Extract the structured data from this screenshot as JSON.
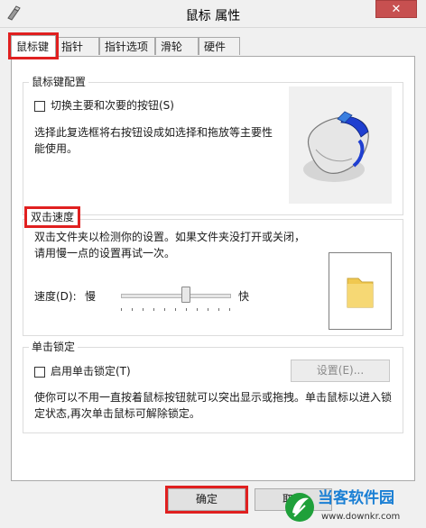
{
  "window": {
    "title": "鼠标 属性",
    "close_glyph": "✕"
  },
  "tabs": [
    {
      "label": "鼠标键"
    },
    {
      "label": "指针"
    },
    {
      "label": "指针选项"
    },
    {
      "label": "滑轮"
    },
    {
      "label": "硬件"
    }
  ],
  "button_config": {
    "group_label": "鼠标键配置",
    "switch_checkbox_label": "切换主要和次要的按钮(S)",
    "switch_checked": false,
    "description": "选择此复选框将右按钮设成如选择和拖放等主要性能使用。"
  },
  "double_click": {
    "group_label": "双击速度",
    "description": "双击文件夹以检测你的设置。如果文件夹没打开或关闭，请用慢一点的设置再试一次。",
    "speed_label": "速度(D):",
    "slow_label": "慢",
    "fast_label": "快",
    "speed_level": 0.6
  },
  "click_lock": {
    "group_label": "单击锁定",
    "checkbox_label": "启用单击锁定(T)",
    "checked": false,
    "settings_button": "设置(E)...",
    "description": "使你可以不用一直按着鼠标按钮就可以突出显示或拖拽。单击鼠标以进入锁定状态,再次单击鼠标可解除锁定。"
  },
  "footer": {
    "ok_label": "确定",
    "cancel_label": "取消"
  },
  "watermark": {
    "brand": "当客软件园",
    "url": "www.downkr.com",
    "brand_color": "#1a7fd4"
  },
  "colors": {
    "highlight": "#e02020",
    "close_red": "#c75050"
  }
}
